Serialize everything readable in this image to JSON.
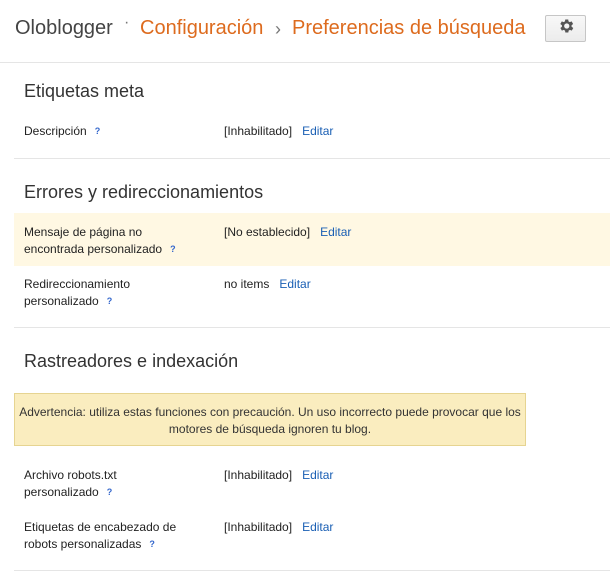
{
  "breadcrumb": {
    "blog_name": "Oloblogger",
    "separator_dot": "·",
    "config": "Configuración",
    "separator_arrow": "›",
    "current": "Preferencias de búsqueda"
  },
  "sections": {
    "meta": {
      "title": "Etiquetas meta",
      "description": {
        "label": "Descripción",
        "help": "?",
        "value": "[Inhabilitado]",
        "edit": "Editar"
      }
    },
    "errors": {
      "title": "Errores y redireccionamientos",
      "not_found": {
        "label": "Mensaje de página no encontrada personalizado",
        "help": "?",
        "value": "[No establecido]",
        "edit": "Editar"
      },
      "redirects": {
        "label": "Redireccionamiento personalizado",
        "help": "?",
        "value": "no items",
        "edit": "Editar"
      }
    },
    "crawlers": {
      "title": "Rastreadores e indexación",
      "warning": "Advertencia: utiliza estas funciones con precaución. Un uso incorrecto puede provocar que los motores de búsqueda ignoren tu blog.",
      "robots_txt": {
        "label": "Archivo robots.txt personalizado",
        "help": "?",
        "value": "[Inhabilitado]",
        "edit": "Editar"
      },
      "robots_tags": {
        "label": "Etiquetas de encabezado de robots personalizadas",
        "help": "?",
        "value": "[Inhabilitado]",
        "edit": "Editar"
      }
    }
  },
  "colors": {
    "accent": "#dd6b1e",
    "link": "#1a5fb4",
    "warning_bg": "#faedbf",
    "highlight_bg": "#fff8e3"
  },
  "icons": {
    "settings": "gear-icon"
  }
}
